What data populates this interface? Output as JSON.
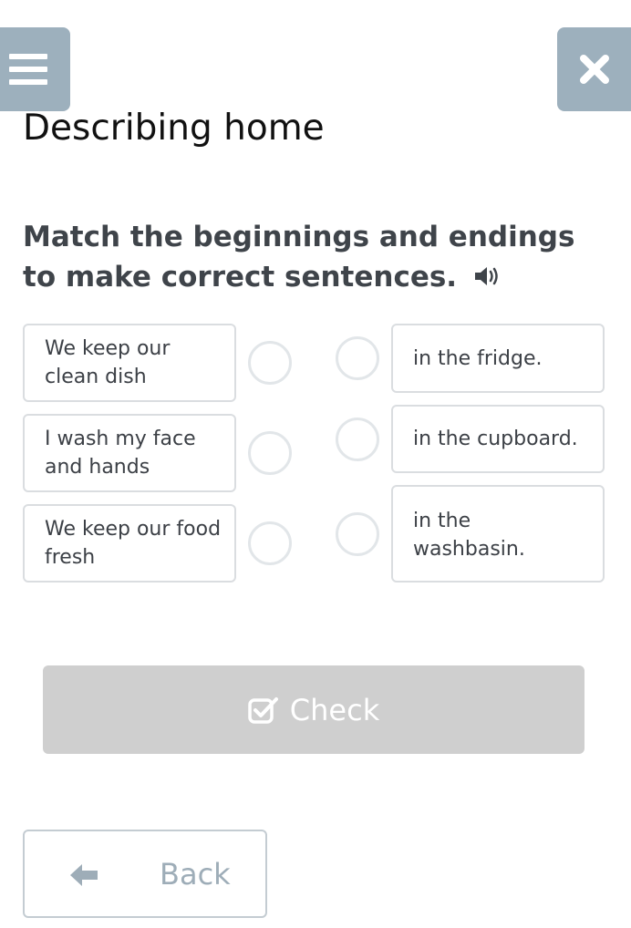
{
  "header": {
    "menu_icon": "hamburger-icon",
    "close_icon": "close-icon",
    "title": "Describing home"
  },
  "exercise": {
    "instruction": "Match the beginnings and endings to make correct sentences.",
    "audio_icon": "speaker-icon",
    "beginnings": [
      {
        "text": "We keep our clean dish"
      },
      {
        "text": "I wash my face and hands"
      },
      {
        "text": "We keep our food fresh"
      }
    ],
    "endings": [
      {
        "text": "in the fridge."
      },
      {
        "text": "in the cupboard."
      },
      {
        "text": "in the washbasin."
      }
    ]
  },
  "actions": {
    "check_label": "Check",
    "check_icon": "checkbox-icon",
    "back_label": "Back",
    "back_icon": "arrow-left-icon"
  },
  "colors": {
    "header_button": "#9db0bd",
    "check_disabled": "#cfcfcf",
    "card_border": "#dadde0",
    "instruction_text": "#3f444a"
  }
}
